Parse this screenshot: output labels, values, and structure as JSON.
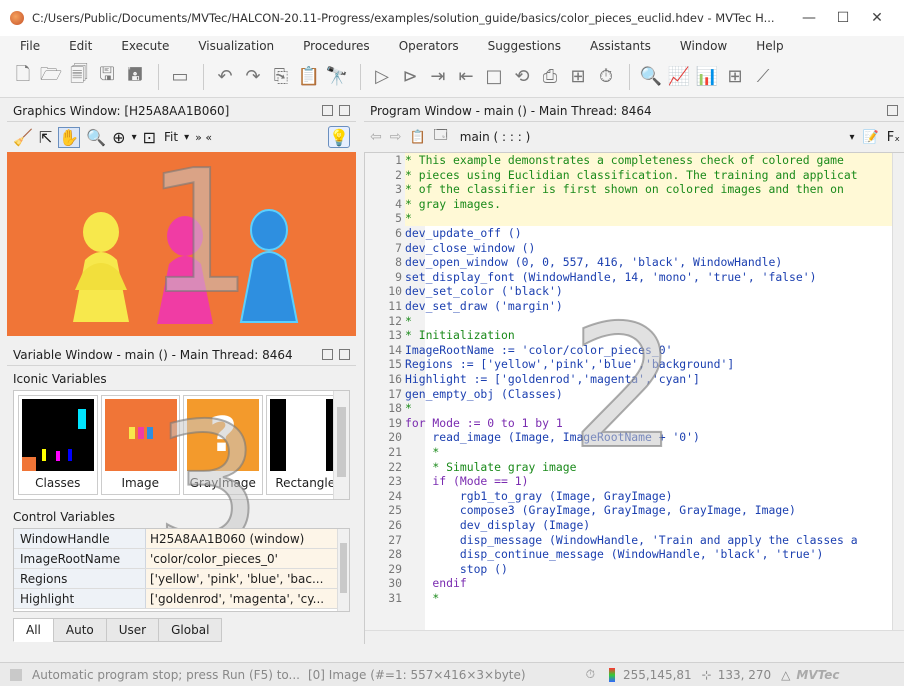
{
  "window": {
    "title": "C:/Users/Public/Documents/MVTec/HALCON-20.11-Progress/examples/solution_guide/basics/color_pieces_euclid.hdev - MVTec H...",
    "controls": [
      "—",
      "☐",
      "✕"
    ]
  },
  "menu": [
    "File",
    "Edit",
    "Execute",
    "Visualization",
    "Procedures",
    "Operators",
    "Suggestions",
    "Assistants",
    "Window",
    "Help"
  ],
  "graphics_window": {
    "title": "Graphics Window: [H25A8AA1B060]",
    "zoom_label": "Fit",
    "overlay_number": "1"
  },
  "variable_window": {
    "title": "Variable Window - main () - Main Thread: 8464",
    "iconic_heading": "Iconic Variables",
    "iconic": [
      "Classes",
      "Image",
      "GrayImage",
      "Rectangle"
    ],
    "control_heading": "Control Variables",
    "control": [
      {
        "name": "WindowHandle",
        "value": "H25A8AA1B060 (window)"
      },
      {
        "name": "ImageRootName",
        "value": "'color/color_pieces_0'"
      },
      {
        "name": "Regions",
        "value": "['yellow', 'pink', 'blue', 'bac..."
      },
      {
        "name": "Highlight",
        "value": "['goldenrod', 'magenta', 'cy..."
      }
    ],
    "tabs": [
      "All",
      "Auto",
      "User",
      "Global"
    ],
    "overlay_number": "3"
  },
  "program_window": {
    "title": "Program Window - main () - Main Thread: 8464",
    "procedure": "main ( : : : )",
    "overlay_number": "2",
    "lines": [
      {
        "n": "1",
        "t": "* This example demonstrates a completeness check of colored game",
        "k": "comment"
      },
      {
        "n": "2",
        "t": "* pieces using Euclidian classification. The training and applicat",
        "k": "comment"
      },
      {
        "n": "3",
        "t": "* of the classifier is first shown on colored images and then on",
        "k": "comment"
      },
      {
        "n": "4",
        "t": "* gray images.",
        "k": "comment"
      },
      {
        "n": "5",
        "t": "*",
        "k": "comment"
      },
      {
        "n": "6",
        "t": "dev_update_off ()",
        "k": "op"
      },
      {
        "n": "7",
        "t": "dev_close_window ()",
        "k": "op"
      },
      {
        "n": "8",
        "t": "dev_open_window (0, 0, 557, 416, 'black', WindowHandle)",
        "k": "op"
      },
      {
        "n": "9",
        "t": "set_display_font (WindowHandle, 14, 'mono', 'true', 'false')",
        "k": "op"
      },
      {
        "n": "10",
        "t": "dev_set_color ('black')",
        "k": "op"
      },
      {
        "n": "11",
        "t": "dev_set_draw ('margin')",
        "k": "op"
      },
      {
        "n": "12",
        "t": "*",
        "k": "comment"
      },
      {
        "n": "13",
        "t": "* Initialization",
        "k": "comment"
      },
      {
        "n": "14",
        "t": "ImageRootName := 'color/color_pieces_0'",
        "k": "op"
      },
      {
        "n": "15",
        "t": "Regions := ['yellow','pink','blue','background']",
        "k": "op"
      },
      {
        "n": "16",
        "t": "Highlight := ['goldenrod','magenta','cyan']",
        "k": "op"
      },
      {
        "n": "17",
        "t": "gen_empty_obj (Classes)",
        "k": "op"
      },
      {
        "n": "18",
        "t": "*",
        "k": "comment"
      },
      {
        "n": "19",
        "t": "for Mode := 0 to 1 by 1",
        "k": "kw"
      },
      {
        "n": "20",
        "t": "    read_image (Image, ImageRootName + '0')",
        "k": "op"
      },
      {
        "n": "21",
        "t": "    *",
        "k": "comment"
      },
      {
        "n": "22",
        "t": "    * Simulate gray image",
        "k": "comment"
      },
      {
        "n": "23",
        "t": "    if (Mode == 1)",
        "k": "kw"
      },
      {
        "n": "24",
        "t": "        rgb1_to_gray (Image, GrayImage)",
        "k": "op"
      },
      {
        "n": "25",
        "t": "        compose3 (GrayImage, GrayImage, GrayImage, Image)",
        "k": "op"
      },
      {
        "n": "26",
        "t": "        dev_display (Image)",
        "k": "op"
      },
      {
        "n": "27",
        "t": "        disp_message (WindowHandle, 'Train and apply the classes a",
        "k": "op"
      },
      {
        "n": "28",
        "t": "        disp_continue_message (WindowHandle, 'black', 'true')",
        "k": "op"
      },
      {
        "n": "29",
        "t": "        stop ()",
        "k": "op"
      },
      {
        "n": "30",
        "t": "    endif",
        "k": "kw"
      },
      {
        "n": "31",
        "t": "    *",
        "k": "comment"
      }
    ]
  },
  "status": {
    "message": "Automatic program stop; press Run (F5) to...",
    "image_info": "[0] Image (#=1: 557×416×3×byte)",
    "pixel_value": "255,145,81",
    "coords": "133, 270",
    "logo": "MVTec"
  }
}
